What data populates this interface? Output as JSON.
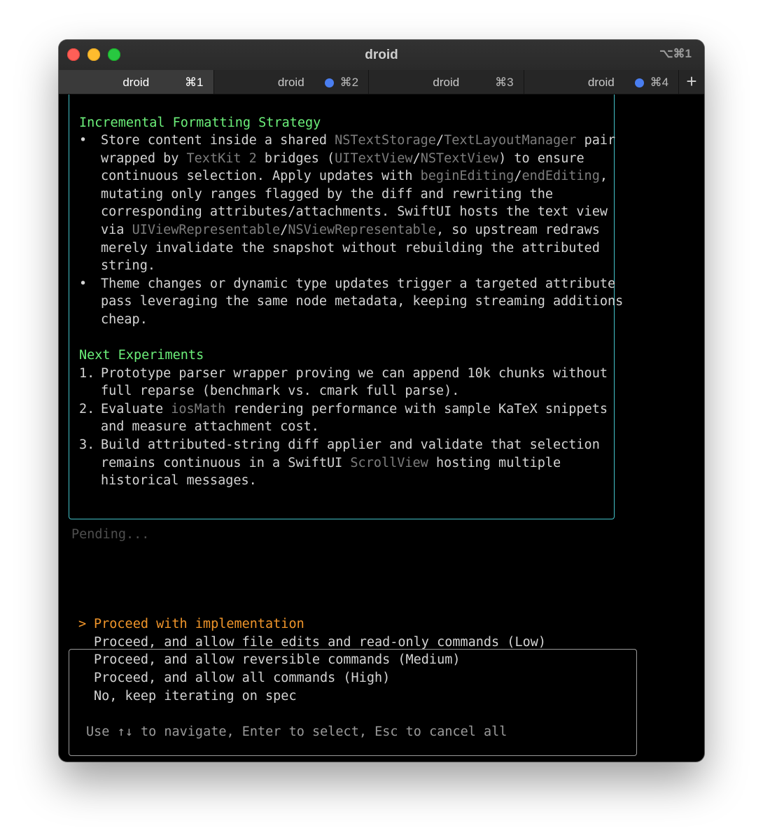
{
  "window": {
    "title": "droid",
    "title_shortcut": "⌥⌘1"
  },
  "tabs": [
    {
      "label": "droid",
      "shortcut": "⌘1",
      "active": true,
      "indicator": false
    },
    {
      "label": "droid",
      "shortcut": "⌘2",
      "active": false,
      "indicator": true
    },
    {
      "label": "droid",
      "shortcut": "⌘3",
      "active": false,
      "indicator": false
    },
    {
      "label": "droid",
      "shortcut": "⌘4",
      "active": false,
      "indicator": true
    }
  ],
  "new_tab_label": "+",
  "message": {
    "section1_heading": "Incremental Formatting Strategy",
    "b1": {
      "bullet": "•",
      "l1": {
        "a": "Store content inside a shared ",
        "c1": "NSTextStorage",
        "sep": "/",
        "c2": "TextLayoutManager",
        "b": " pair"
      },
      "l2": {
        "a": "wrapped by ",
        "c1": "TextKit 2",
        "b": " bridges (",
        "c2": "UITextView",
        "sep": "/",
        "c3": "NSTextView",
        "d": ") to ensure"
      },
      "l3": {
        "a": "continuous selection. Apply updates with ",
        "c1": "beginEditing",
        "sep": "/",
        "c2": "endEditing",
        "b": ","
      },
      "l4": "mutating only ranges flagged by the diff and rewriting the",
      "l5": "corresponding attributes/attachments. SwiftUI hosts the text view",
      "l6": {
        "a": "via ",
        "c1": "UIViewRepresentable",
        "sep": "/",
        "c2": "NSViewRepresentable",
        "b": ", so upstream redraws"
      },
      "l7": "merely invalidate the snapshot without rebuilding the attributed",
      "l8": "string."
    },
    "b2": {
      "bullet": "•",
      "l1": "Theme changes or dynamic type updates trigger a targeted attribute",
      "l2": "pass leveraging the same node metadata, keeping streaming additions",
      "l3": "cheap."
    },
    "section2_heading": "Next Experiments",
    "n1": {
      "num": "1.",
      "l1": "Prototype parser wrapper proving we can append 10k chunks without",
      "l2": "full reparse (benchmark vs. cmark full parse)."
    },
    "n2": {
      "num": "2.",
      "l1": {
        "a": "Evaluate ",
        "c1": "iosMath",
        "b": " rendering performance with sample KaTeX snippets"
      },
      "l2": "and measure attachment cost."
    },
    "n3": {
      "num": "3.",
      "l1": "Build attributed-string diff applier and validate that selection",
      "l2": {
        "a": "remains continuous in a SwiftUI ",
        "c1": "ScrollView",
        "b": " hosting multiple"
      },
      "l3": "historical messages."
    }
  },
  "status": {
    "pending": "Pending..."
  },
  "prompt": {
    "cursor": ">",
    "options": [
      "Proceed with implementation",
      "Proceed, and allow file edits and read-only commands (Low)",
      "Proceed, and allow reversible commands (Medium)",
      "Proceed, and allow all commands (High)",
      "No, keep iterating on spec"
    ],
    "selected_index": 0,
    "hint": "Use ↑↓ to navigate, Enter to select, Esc to cancel all"
  },
  "colors": {
    "heading": "#6cf07a",
    "code": "#7d7d7d",
    "selected": "#f0952a",
    "border_message": "#44c2c9",
    "tab_indicator": "#4a7ef0"
  }
}
